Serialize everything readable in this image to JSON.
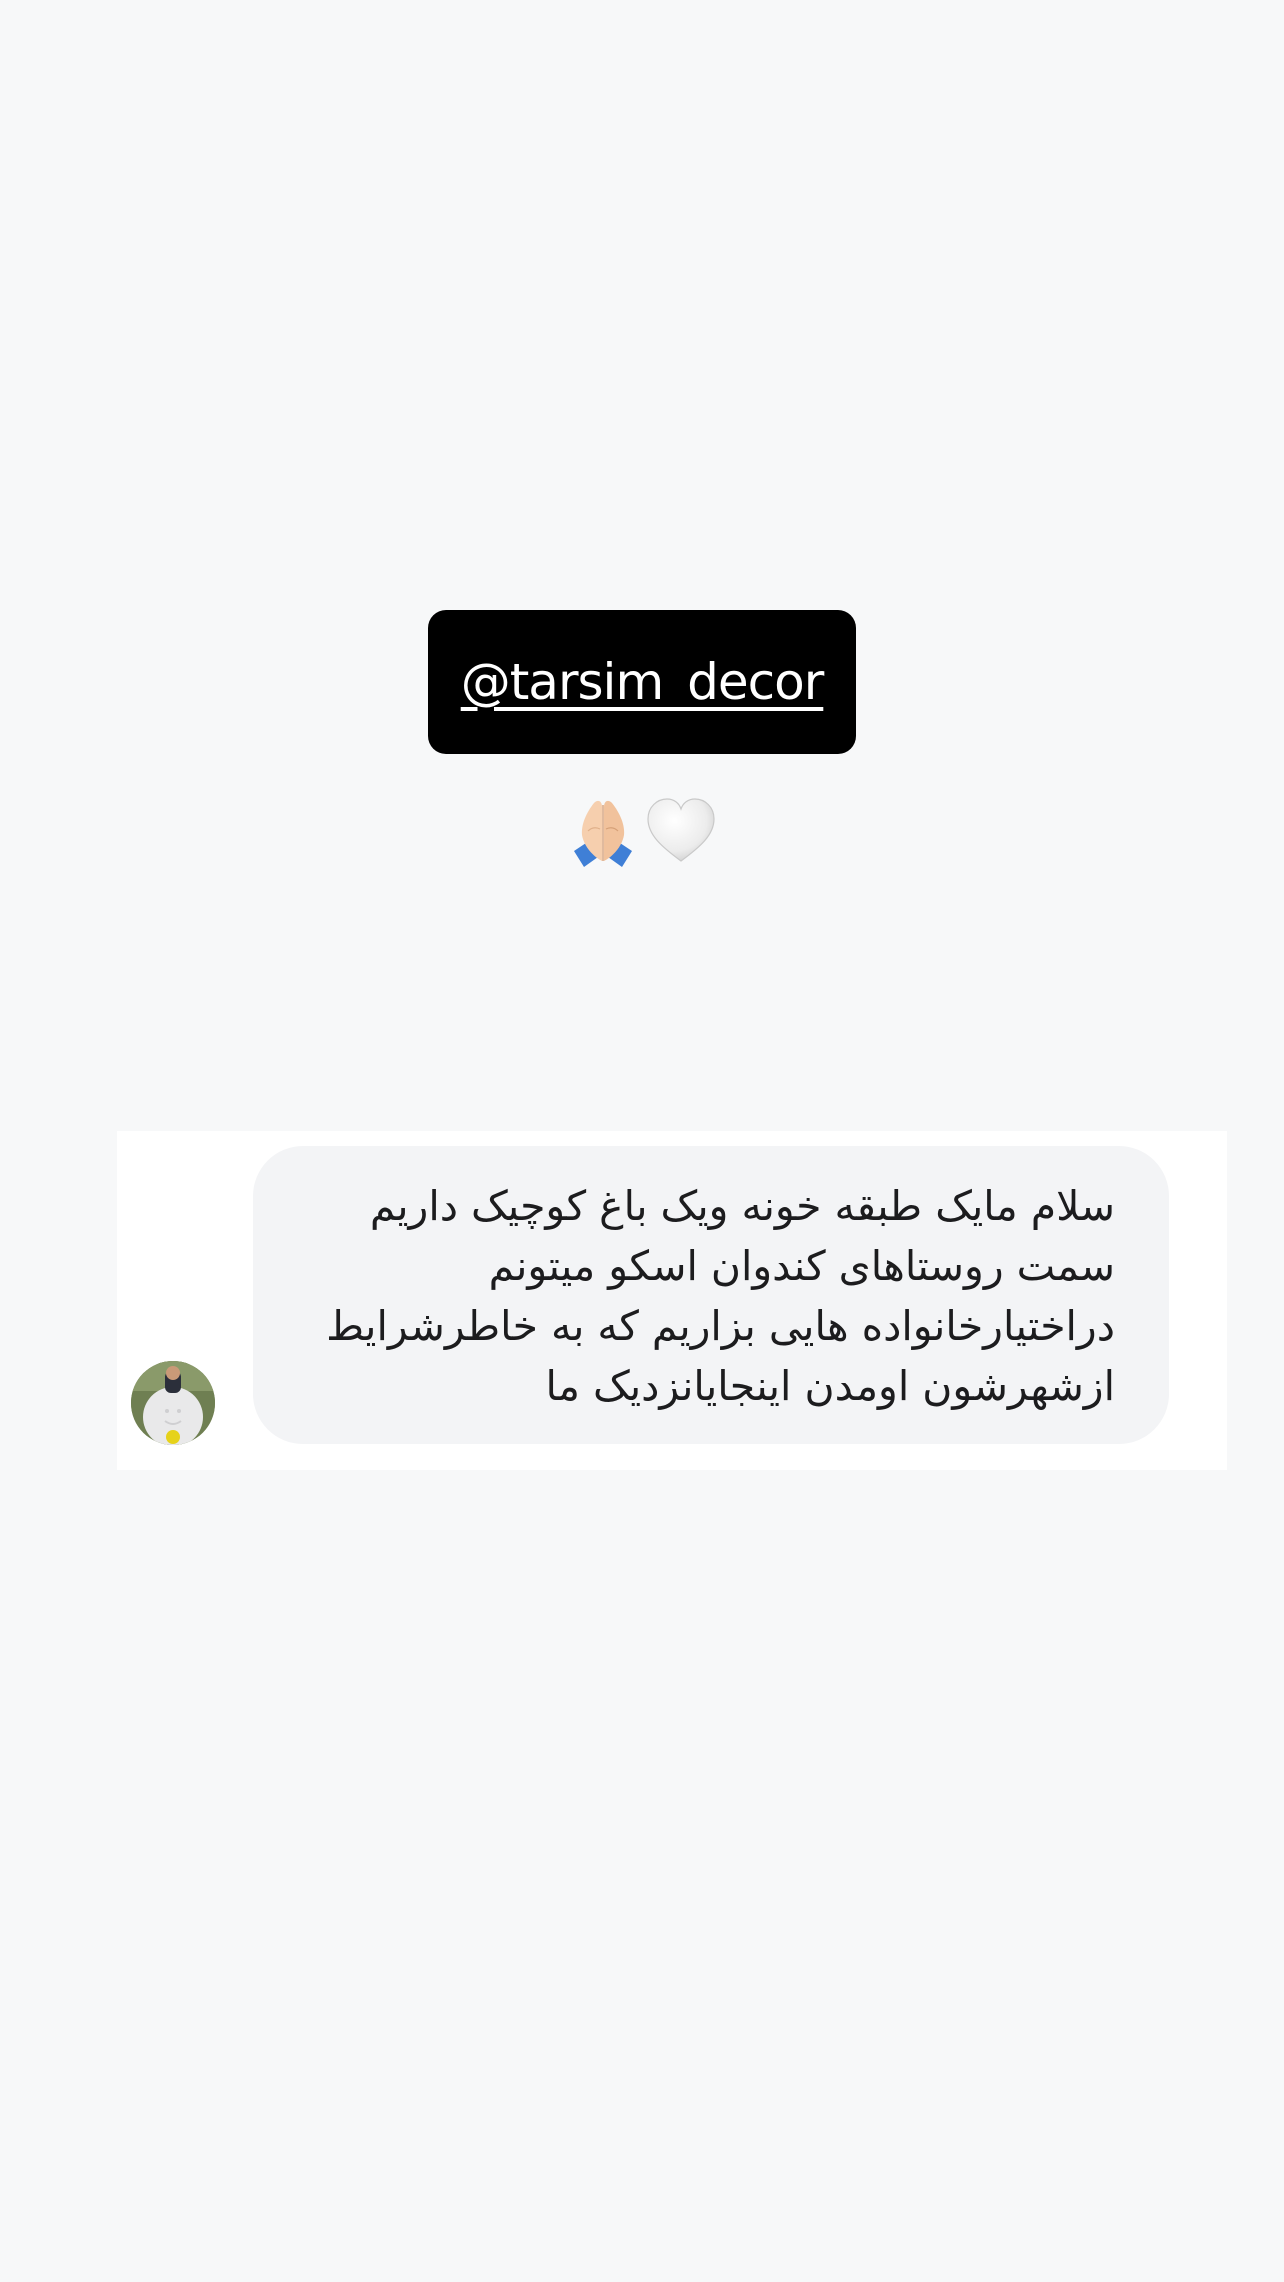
{
  "sticker": {
    "mention": "@tarsim_decor"
  },
  "emojis": {
    "items": [
      "folded-hands",
      "white-heart"
    ]
  },
  "reply": {
    "message": "سلام مایک طبقه خونه ویک باغ کوچیک داریم سمت روستاهای کندوان اسکو میتونم دراختیارخانواده هایی بزاریم که به خاطرشرایط ازشهرشون اومدن اینجایانزدیک ما"
  },
  "colors": {
    "background": "#f7f8f9",
    "sticker_bg": "#000000",
    "sticker_text": "#ffffff",
    "bubble_bg": "#f3f4f6",
    "card_bg": "#ffffff"
  }
}
